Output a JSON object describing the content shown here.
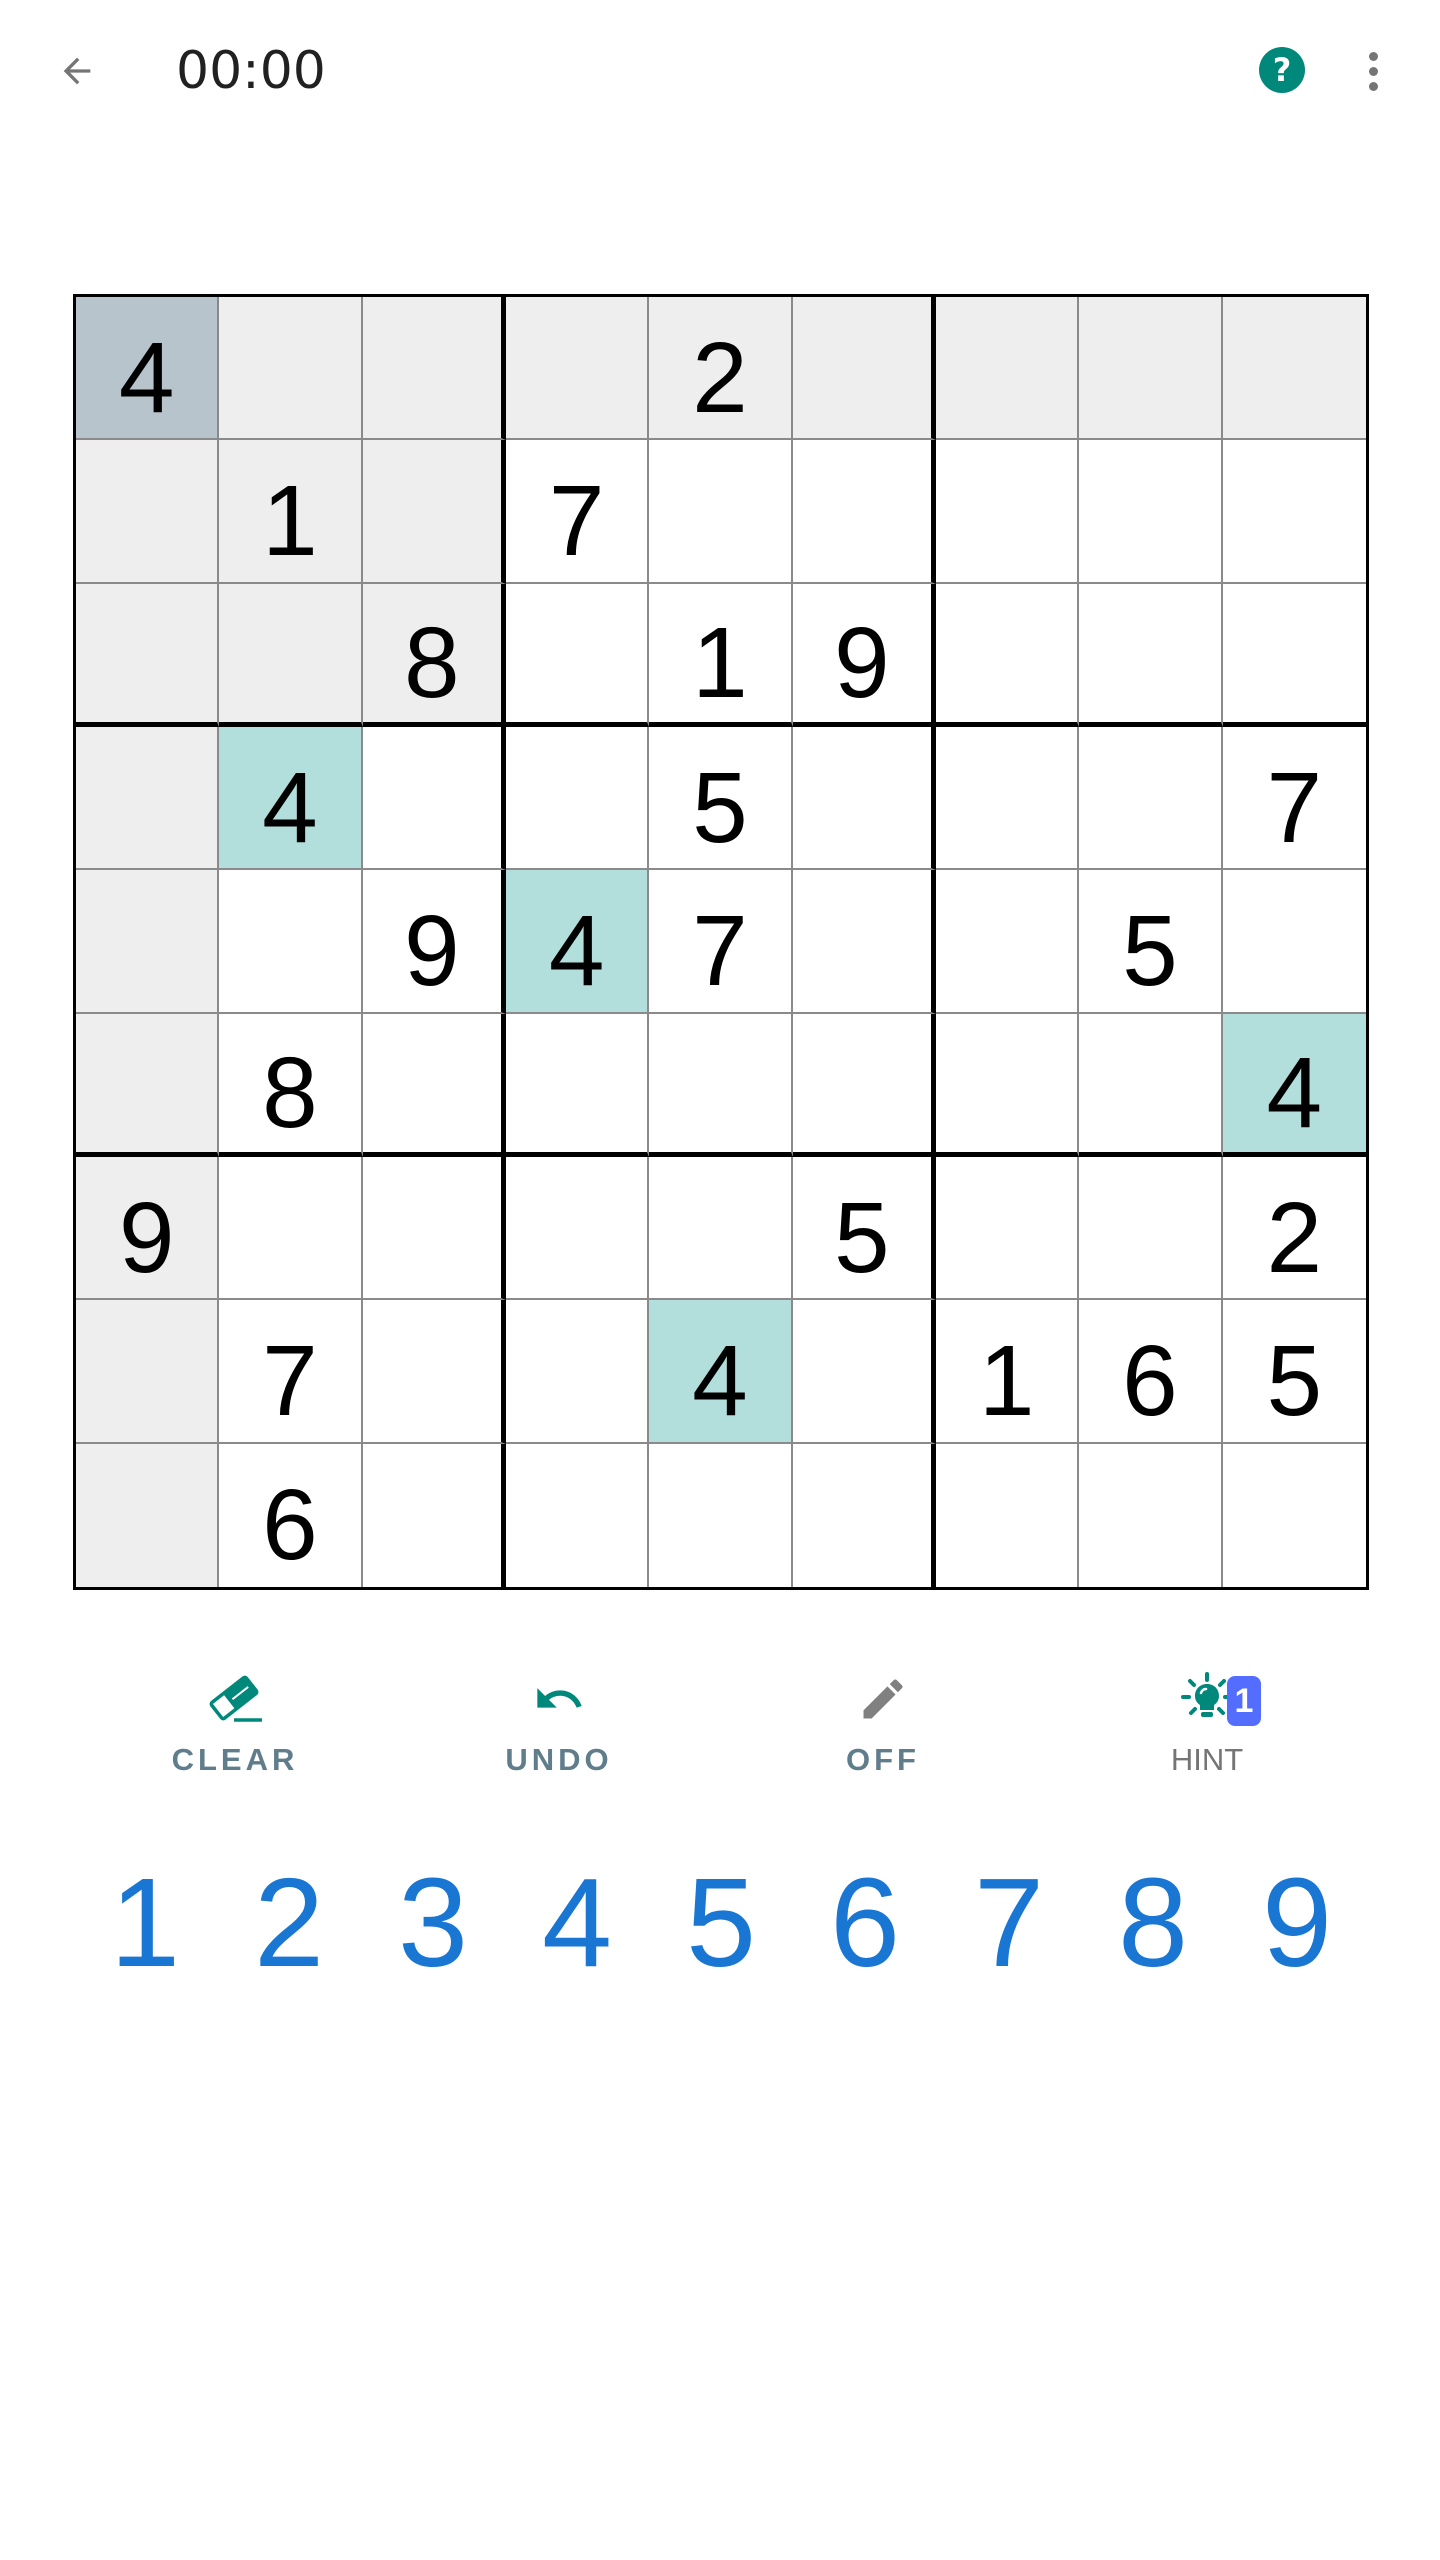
{
  "header": {
    "back_icon": "arrow-left-icon",
    "timer": "00:00",
    "help_icon": "help-circle-icon",
    "help_glyph": "?",
    "menu_icon": "more-vert-icon"
  },
  "board": {
    "size": 9,
    "selected": {
      "row": 1,
      "col": 1,
      "value": 4
    },
    "colors": {
      "selected_cell": "#b8c4cb",
      "related_cell": "#eeeeee",
      "same_value_cell": "#b2dfdb",
      "empty_cell": "#ffffff"
    },
    "rows": [
      [
        "4",
        "",
        "",
        "",
        "2",
        "",
        "",
        "",
        ""
      ],
      [
        "",
        "1",
        "",
        "7",
        "",
        "",
        "",
        "",
        ""
      ],
      [
        "",
        "",
        "8",
        "",
        "1",
        "9",
        "",
        "",
        ""
      ],
      [
        "",
        "4",
        "",
        "",
        "5",
        "",
        "",
        "",
        "7"
      ],
      [
        "",
        "",
        "9",
        "4",
        "7",
        "",
        "",
        "5",
        ""
      ],
      [
        "",
        "8",
        "",
        "",
        "",
        "",
        "",
        "",
        "4"
      ],
      [
        "9",
        "",
        "",
        "",
        "",
        "5",
        "",
        "",
        "2"
      ],
      [
        "",
        "7",
        "",
        "",
        "4",
        "",
        "1",
        "6",
        "5"
      ],
      [
        "",
        "6",
        "",
        "",
        "",
        "",
        "",
        "",
        ""
      ]
    ]
  },
  "actions": [
    {
      "id": "clear",
      "label": "CLEAR",
      "icon": "eraser-icon",
      "color": "#00897b"
    },
    {
      "id": "undo",
      "label": "UNDO",
      "icon": "undo-icon",
      "color": "#00897b"
    },
    {
      "id": "notes",
      "label": "OFF",
      "icon": "pencil-icon",
      "color": "#808080"
    },
    {
      "id": "hint",
      "label": "HINT",
      "icon": "lightbulb-icon",
      "color": "#00897b",
      "badge": "1",
      "badge_color": "#536dfe"
    }
  ],
  "numpad": {
    "color": "#1976d2",
    "digits": [
      "1",
      "2",
      "3",
      "4",
      "5",
      "6",
      "7",
      "8",
      "9"
    ]
  }
}
